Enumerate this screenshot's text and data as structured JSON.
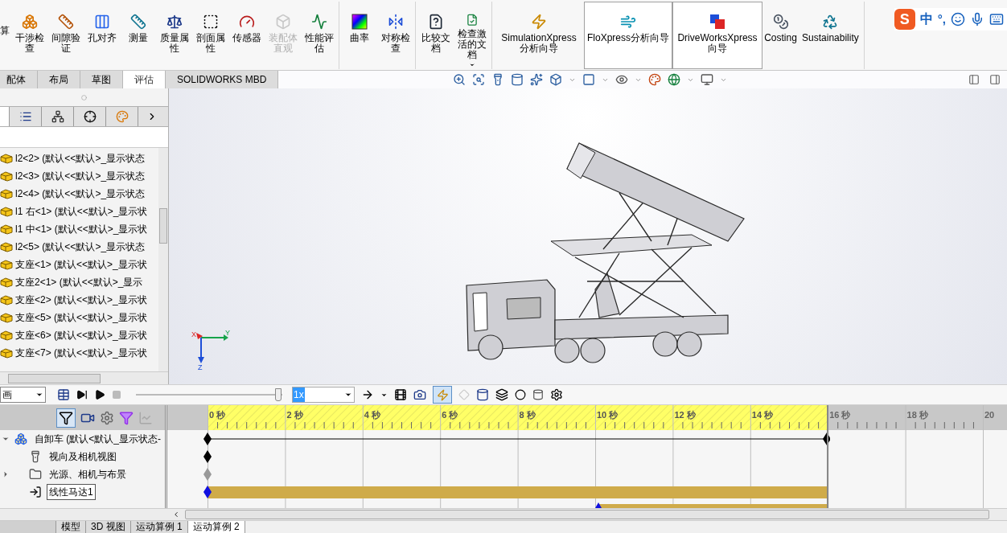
{
  "ribbon": {
    "cut_label": "算",
    "groups": [
      {
        "tools": [
          {
            "label": "干涉检查",
            "disabled": false,
            "framed": false,
            "dropdown": false
          },
          {
            "label": "间隙验证",
            "disabled": false,
            "framed": false,
            "dropdown": false
          },
          {
            "label": "孔对齐",
            "disabled": false,
            "framed": false,
            "dropdown": false
          },
          {
            "label": "测量",
            "disabled": false,
            "framed": false,
            "dropdown": false
          },
          {
            "label": "质量属性",
            "disabled": false,
            "framed": false,
            "dropdown": false
          },
          {
            "label": "剖面属性",
            "disabled": false,
            "framed": false,
            "dropdown": false
          },
          {
            "label": "传感器",
            "disabled": false,
            "framed": false,
            "dropdown": false
          },
          {
            "label": "装配体直观",
            "disabled": true,
            "framed": false,
            "dropdown": false
          },
          {
            "label": "性能评估",
            "disabled": false,
            "framed": false,
            "dropdown": false
          }
        ]
      },
      {
        "tools": [
          {
            "label": "曲率",
            "disabled": false,
            "framed": false,
            "dropdown": false
          },
          {
            "label": "对称检查",
            "disabled": false,
            "framed": false,
            "dropdown": false
          }
        ]
      },
      {
        "tools": [
          {
            "label": "比较文档",
            "disabled": false,
            "framed": false,
            "dropdown": false
          },
          {
            "label": "检查激活的文档",
            "disabled": false,
            "framed": false,
            "dropdown": true
          }
        ]
      },
      {
        "tools": [
          {
            "label": "SimulationXpress分析向导",
            "disabled": false,
            "framed": false,
            "dropdown": false
          },
          {
            "label": "FloXpress分析向导",
            "disabled": false,
            "framed": true,
            "dropdown": false
          },
          {
            "label": "DriveWorksXpress向导",
            "disabled": false,
            "framed": true,
            "dropdown": false
          },
          {
            "label": "Costing",
            "disabled": false,
            "framed": false,
            "dropdown": false
          },
          {
            "label": "Sustainability",
            "disabled": false,
            "framed": false,
            "dropdown": false
          }
        ]
      }
    ]
  },
  "ime": {
    "logo": "S",
    "mode": "中",
    "punct": "°,"
  },
  "tabs": [
    {
      "label": "配体",
      "selected": false
    },
    {
      "label": "布局",
      "selected": false
    },
    {
      "label": "草图",
      "selected": false
    },
    {
      "label": "评估",
      "selected": true
    },
    {
      "label": "SOLIDWORKS MBD",
      "selected": false
    }
  ],
  "manager_tabs": [
    {
      "selected": true
    },
    {
      "selected": false
    },
    {
      "selected": false
    },
    {
      "selected": false
    },
    {
      "selected": false
    }
  ],
  "feature_tree": {
    "items": [
      {
        "label": "l2<2> (默认<<默认>_显示状态"
      },
      {
        "label": "l2<3> (默认<<默认>_显示状态"
      },
      {
        "label": "l2<4> (默认<<默认>_显示状态"
      },
      {
        "label": "l1 右<1> (默认<<默认>_显示状"
      },
      {
        "label": "l1 中<1> (默认<<默认>_显示状"
      },
      {
        "label": "l2<5> (默认<<默认>_显示状态"
      },
      {
        "label": "支座<1> (默认<<默认>_显示状"
      },
      {
        "label": "支座2<1> (默认<<默认>_显示"
      },
      {
        "label": "支座<2> (默认<<默认>_显示状"
      },
      {
        "label": "支座<5> (默认<<默认>_显示状"
      },
      {
        "label": "支座<6> (默认<<默认>_显示状"
      },
      {
        "label": "支座<7> (默认<<默认>_显示状"
      }
    ]
  },
  "triad": {
    "x": "X",
    "y": "Y",
    "z": "Z"
  },
  "motion": {
    "study_type": "画",
    "speed": "1x",
    "autokey": true,
    "playback": {
      "level": 0.97
    }
  },
  "timeline": {
    "ticks": [
      {
        "label": "0 秒",
        "calculated": true
      },
      {
        "label": "2 秒",
        "calculated": true
      },
      {
        "label": "4 秒",
        "calculated": true
      },
      {
        "label": "6 秒",
        "calculated": true
      },
      {
        "label": "8 秒",
        "calculated": true
      },
      {
        "label": "10 秒",
        "calculated": true
      },
      {
        "label": "12 秒",
        "calculated": true
      },
      {
        "label": "14 秒",
        "calculated": true
      },
      {
        "label": "16 秒",
        "calculated": false
      },
      {
        "label": "18 秒",
        "calculated": false
      },
      {
        "label": "20",
        "calculated": false
      }
    ],
    "tree": [
      {
        "label": "自卸车  (默认<默认_显示状态-",
        "kind": "assembly",
        "expanded": true,
        "selected": false
      },
      {
        "label": "视向及相机视图",
        "kind": "camera",
        "selected": false
      },
      {
        "label": "光源、相机与布景",
        "kind": "folder",
        "expanded": false,
        "selected": false
      },
      {
        "label": "线性马达1",
        "kind": "motor",
        "selected": true
      }
    ]
  },
  "bottom_tabs": [
    {
      "label": "模型",
      "selected": false
    },
    {
      "label": "3D 视图",
      "selected": false
    },
    {
      "label": "运动算例 1",
      "selected": false
    },
    {
      "label": "运动算例 2",
      "selected": true
    }
  ]
}
